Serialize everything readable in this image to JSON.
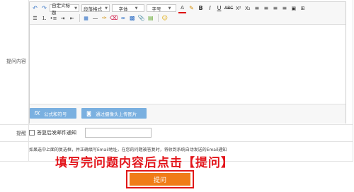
{
  "labels": {
    "question_content": "提问内容",
    "reminder": "提醒"
  },
  "toolbar": {
    "heading_select": "自定义标题",
    "paragraph_select": "段落格式",
    "font_select": "字体",
    "size_select": "字号",
    "bold": "B",
    "italic": "I",
    "underline": "U",
    "strike": "ABC",
    "superscript": "X²",
    "subscript": "X₂"
  },
  "editor_bottom": {
    "formula_button": "公式和符号",
    "camera_button": "通过摄像头上传图片"
  },
  "reminder": {
    "checkbox_label": "答复后发邮件通知",
    "email_value": ""
  },
  "note": "如果选中上面的复选框，并正确填写Email地址，在您的问题被答复时，将收到系统自动发送的Email通知",
  "annotation": "填写完问题内容后点击【提问】",
  "submit_label": "提问",
  "colors": {
    "blue_button": "#7ab0e0",
    "submit": "#f07c18",
    "annotation": "#e3151b"
  }
}
